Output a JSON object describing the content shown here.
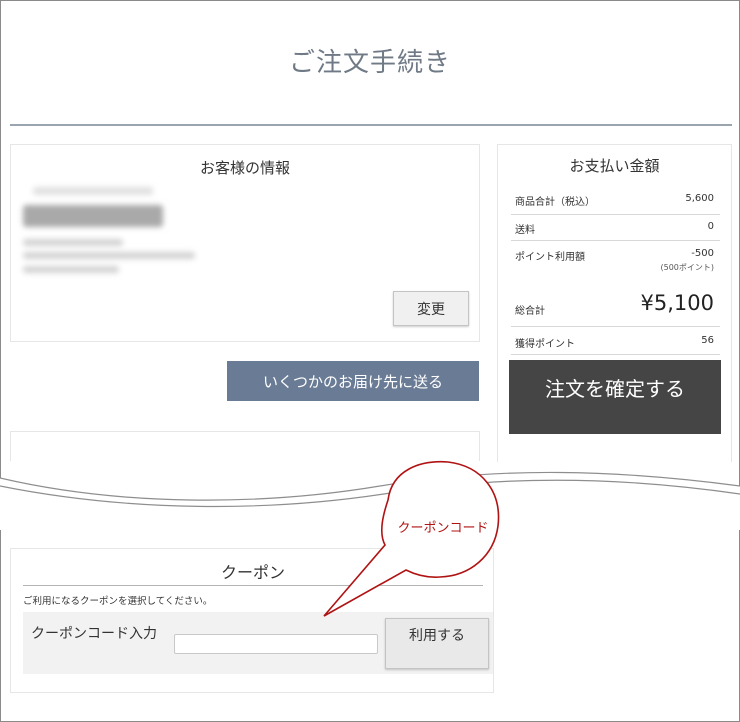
{
  "page": {
    "title": "ご注文手続き"
  },
  "customer": {
    "heading": "お客様の情報",
    "change_label": "変更"
  },
  "shipping": {
    "multi_ship_label": "いくつかのお届け先に送る"
  },
  "payment": {
    "heading": "お支払い金額",
    "rows": [
      {
        "label": "商品合計（税込）",
        "value": "5,600"
      },
      {
        "label": "送料",
        "value": "0"
      },
      {
        "label": "ポイント利用額",
        "value": "-500",
        "sub": "(500ポイント)"
      },
      {
        "label": "総合計",
        "value": "¥5,100"
      },
      {
        "label": "獲得ポイント",
        "value": "56"
      }
    ],
    "confirm_label": "注文を確定する"
  },
  "coupon": {
    "heading": "クーポン",
    "description": "ご利用になるクーポンを選択してください。",
    "input_label": "クーポンコード入力",
    "input_value": "",
    "apply_label": "利用する"
  },
  "annotation": {
    "callout_text": "クーポンコード",
    "callout_color": "#b01313"
  }
}
